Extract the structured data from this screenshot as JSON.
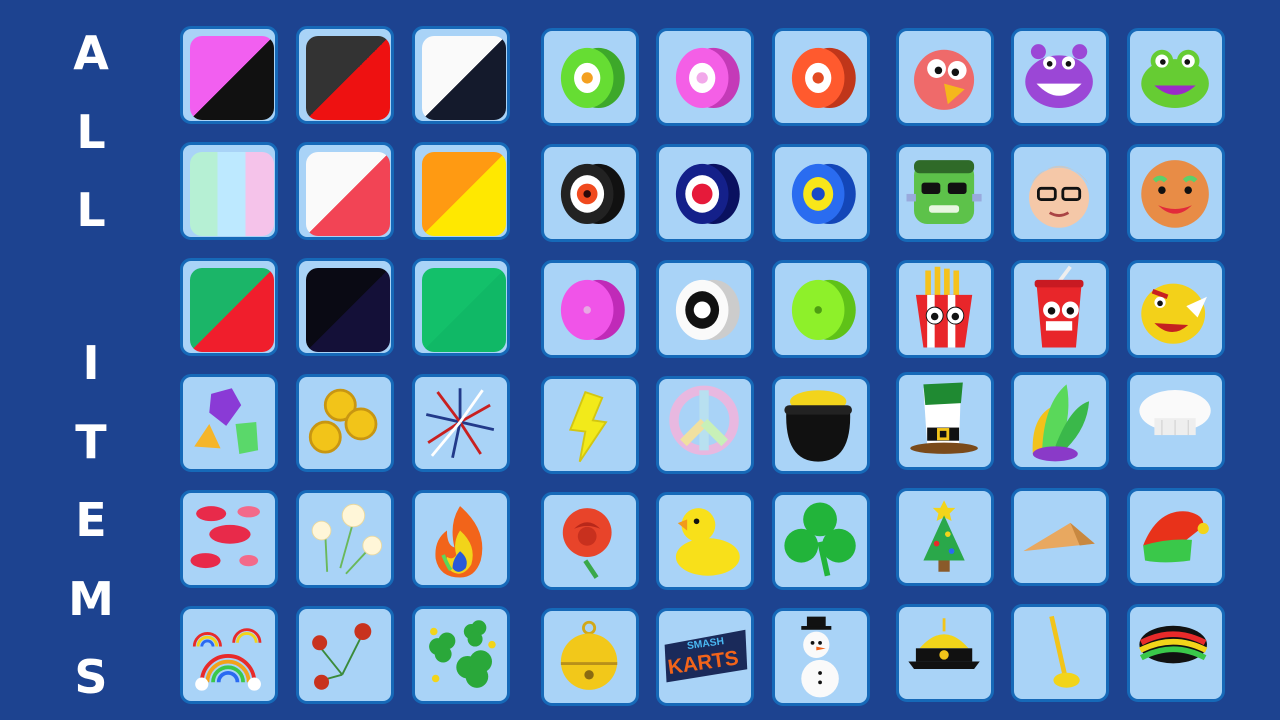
{
  "title_letters": [
    "A",
    "L",
    "L",
    "I",
    "T",
    "E",
    "M",
    "S"
  ],
  "logo_text": {
    "line1": "SMASH",
    "line2": "KARTS"
  },
  "grid": {
    "columns": [
      "c1",
      "c2",
      "c3",
      "c4",
      "c5",
      "c6",
      "c7",
      "c8",
      "c9"
    ],
    "rows": [
      "r1",
      "r2",
      "r3",
      "r4",
      "r5",
      "r6"
    ]
  },
  "tile_colors": {
    "tile_bg": "#a9d3f7",
    "tile_border": "#1669b8",
    "page_bg": "#1d4390"
  },
  "items": [
    {
      "id": "paint-pink-black",
      "icon": "paint-swatch-icon"
    },
    {
      "id": "paint-gray-red",
      "icon": "paint-swatch-icon"
    },
    {
      "id": "paint-white-navy",
      "icon": "paint-swatch-icon"
    },
    {
      "id": "wheel-green",
      "icon": "wheel-icon"
    },
    {
      "id": "wheel-pink",
      "icon": "wheel-icon"
    },
    {
      "id": "wheel-orange",
      "icon": "wheel-icon"
    },
    {
      "id": "head-bird",
      "icon": "bird-head-icon"
    },
    {
      "id": "head-hippo",
      "icon": "hippo-head-icon"
    },
    {
      "id": "head-frog",
      "icon": "frog-head-icon"
    },
    {
      "id": "paint-pastel-stripes",
      "icon": "paint-swatch-icon"
    },
    {
      "id": "paint-white-red",
      "icon": "paint-swatch-icon"
    },
    {
      "id": "paint-orange-yellow",
      "icon": "paint-swatch-icon"
    },
    {
      "id": "wheel-black-red",
      "icon": "wheel-icon"
    },
    {
      "id": "wheel-navy-red",
      "icon": "wheel-icon"
    },
    {
      "id": "wheel-blue-yellow",
      "icon": "wheel-icon"
    },
    {
      "id": "head-zombie",
      "icon": "zombie-head-icon"
    },
    {
      "id": "head-grandpa",
      "icon": "grandpa-head-icon"
    },
    {
      "id": "head-gingerbread",
      "icon": "gingerbread-head-icon"
    },
    {
      "id": "paint-green-red",
      "icon": "paint-swatch-icon"
    },
    {
      "id": "paint-black",
      "icon": "paint-swatch-icon"
    },
    {
      "id": "paint-green",
      "icon": "paint-swatch-icon"
    },
    {
      "id": "wheel-magenta",
      "icon": "wheel-icon"
    },
    {
      "id": "wheel-white-black",
      "icon": "wheel-icon"
    },
    {
      "id": "wheel-lime",
      "icon": "wheel-icon"
    },
    {
      "id": "head-fries",
      "icon": "fries-head-icon"
    },
    {
      "id": "head-soda",
      "icon": "soda-head-icon"
    },
    {
      "id": "head-rhino",
      "icon": "rhino-head-icon"
    },
    {
      "id": "trail-gems",
      "icon": "gems-icon"
    },
    {
      "id": "trail-coins",
      "icon": "coins-icon"
    },
    {
      "id": "trail-fireworks",
      "icon": "fireworks-icon"
    },
    {
      "id": "horn-lightning",
      "icon": "lightning-icon"
    },
    {
      "id": "horn-peace",
      "icon": "peace-sign-icon"
    },
    {
      "id": "horn-pot-of-gold",
      "icon": "pot-of-gold-icon"
    },
    {
      "id": "hat-leprechaun",
      "icon": "leprechaun-hat-icon"
    },
    {
      "id": "hat-feather",
      "icon": "feather-hat-icon"
    },
    {
      "id": "hat-chef",
      "icon": "chef-hat-icon"
    },
    {
      "id": "trail-kisses",
      "icon": "lips-icon"
    },
    {
      "id": "trail-popcorn",
      "icon": "popcorn-icon"
    },
    {
      "id": "trail-rainbow-fire",
      "icon": "fire-icon"
    },
    {
      "id": "horn-rose",
      "icon": "rose-icon"
    },
    {
      "id": "horn-duck",
      "icon": "rubber-duck-icon"
    },
    {
      "id": "horn-shamrock",
      "icon": "shamrock-icon"
    },
    {
      "id": "hat-xmas-tree",
      "icon": "christmas-tree-icon"
    },
    {
      "id": "hat-conical",
      "icon": "conical-hat-icon"
    },
    {
      "id": "hat-elf",
      "icon": "elf-hat-icon"
    },
    {
      "id": "trail-rainbows",
      "icon": "rainbow-icon"
    },
    {
      "id": "trail-roses",
      "icon": "roses-icon"
    },
    {
      "id": "trail-shamrocks",
      "icon": "shamrocks-icon"
    },
    {
      "id": "horn-bell",
      "icon": "bell-icon"
    },
    {
      "id": "horn-smash-karts",
      "icon": "smash-karts-logo-icon"
    },
    {
      "id": "horn-snowman",
      "icon": "snowman-icon"
    },
    {
      "id": "hat-chinese",
      "icon": "chinese-hat-icon"
    },
    {
      "id": "hat-plunger",
      "icon": "plunger-icon"
    },
    {
      "id": "hat-rasta",
      "icon": "rasta-cap-icon"
    }
  ]
}
